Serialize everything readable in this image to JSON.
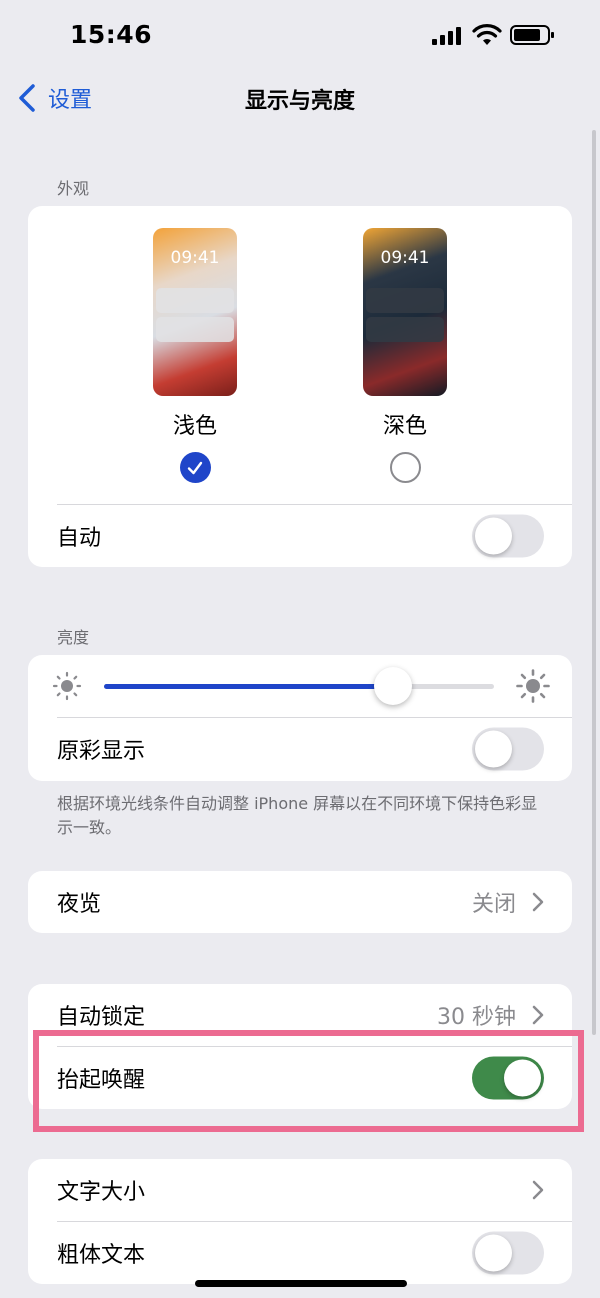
{
  "status_bar": {
    "time": "15:46"
  },
  "nav": {
    "back_label": "设置",
    "title": "显示与亮度"
  },
  "appearance": {
    "header": "外观",
    "options": [
      {
        "label": "浅色",
        "preview_time": "09:41",
        "selected": true
      },
      {
        "label": "深色",
        "preview_time": "09:41",
        "selected": false
      }
    ],
    "auto_label": "自动",
    "auto_on": false
  },
  "brightness": {
    "header": "亮度",
    "level": 0.74,
    "true_tone_label": "原彩显示",
    "true_tone_on": false,
    "footnote": "根据环境光线条件自动调整 iPhone 屏幕以在不同环境下保持色彩显示一致。"
  },
  "night_shift": {
    "label": "夜览",
    "value": "关闭"
  },
  "lock": {
    "auto_lock_label": "自动锁定",
    "auto_lock_value": "30 秒钟",
    "raise_to_wake_label": "抬起唤醒",
    "raise_to_wake_on": true
  },
  "text": {
    "text_size_label": "文字大小",
    "bold_text_label": "粗体文本",
    "bold_text_on": false
  },
  "colors": {
    "accent": "#1f45c9",
    "toggle_on": "#3f8a4a",
    "highlight": "#ec6b91",
    "link": "#1f5cd6"
  }
}
